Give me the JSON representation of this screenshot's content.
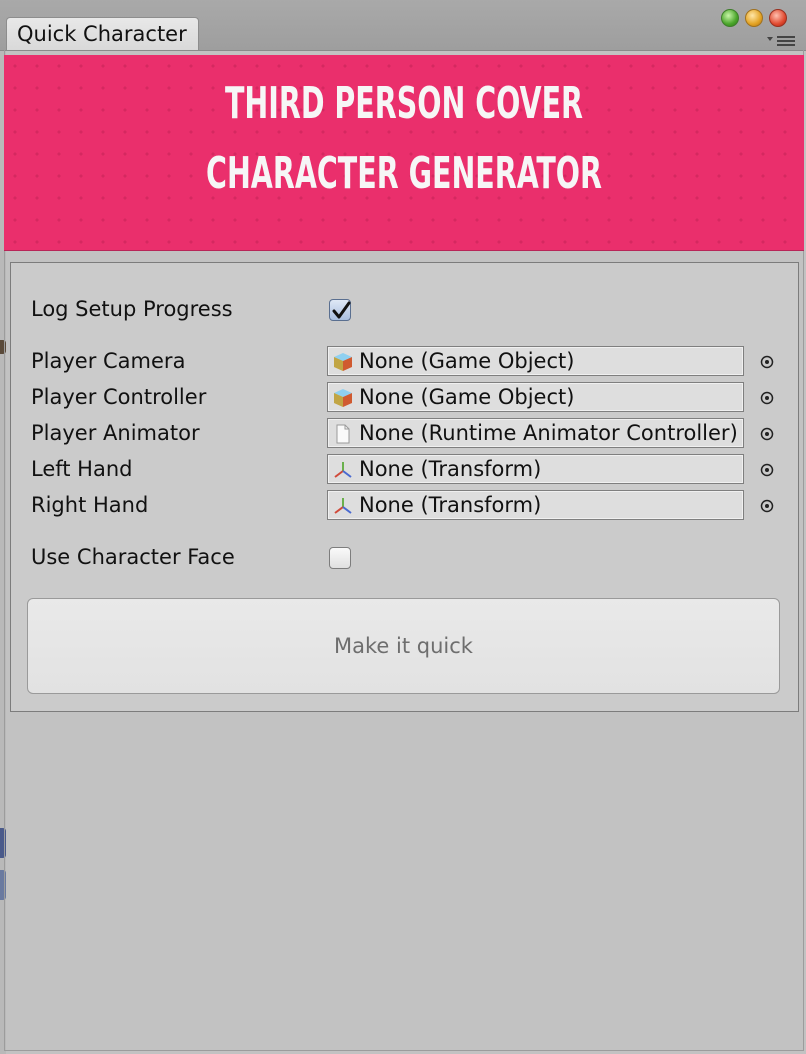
{
  "window": {
    "tab_title": "Quick Character",
    "controls": [
      "zoom-button",
      "minimize-button",
      "close-button"
    ],
    "menu_icon": "context-menu-icon"
  },
  "banner": {
    "line1": "THIRD PERSON COVER",
    "line2": "CHARACTER GENERATOR",
    "color": "#ea2f6c"
  },
  "form": {
    "log_setup": {
      "label": "Log Setup Progress",
      "checked": true
    },
    "fields": [
      {
        "label": "Player Camera",
        "value": "None (Game Object)",
        "icon": "game-object-cube-icon"
      },
      {
        "label": "Player Controller",
        "value": "None (Game Object)",
        "icon": "game-object-cube-icon"
      },
      {
        "label": "Player Animator",
        "value": "None (Runtime Animator Controller)",
        "icon": "asset-file-icon"
      },
      {
        "label": "Left Hand",
        "value": "None (Transform)",
        "icon": "transform-axes-icon"
      },
      {
        "label": "Right Hand",
        "value": "None (Transform)",
        "icon": "transform-axes-icon"
      }
    ],
    "use_face": {
      "label": "Use Character Face",
      "checked": false
    },
    "button_label": "Make it quick"
  }
}
